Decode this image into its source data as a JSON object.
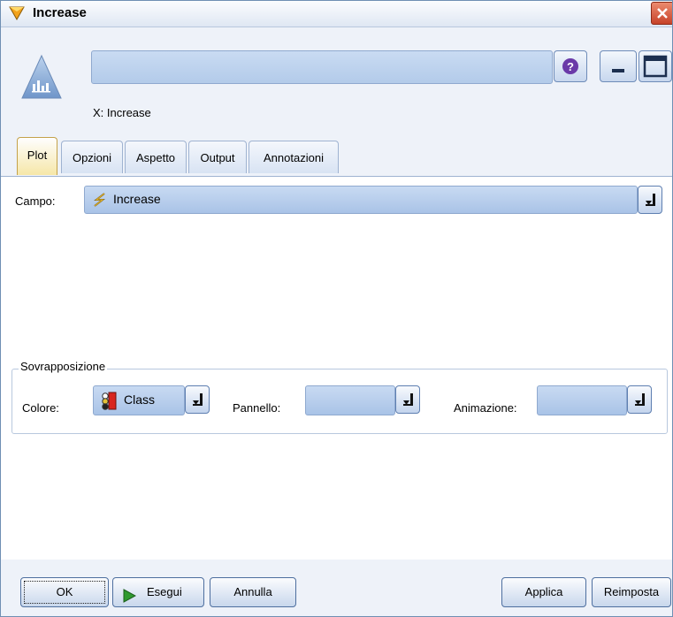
{
  "window": {
    "title": "Increase"
  },
  "header": {
    "node_name": "",
    "x_label": "X: Increase"
  },
  "tabs": [
    {
      "label": "Plot"
    },
    {
      "label": "Opzioni"
    },
    {
      "label": "Aspetto"
    },
    {
      "label": "Output"
    },
    {
      "label": "Annotazioni"
    }
  ],
  "plot": {
    "field_label": "Campo:",
    "field_value": "Increase",
    "overlay_group": "Sovrapposizione",
    "color_label": "Colore:",
    "color_value": "Class",
    "panel_label": "Pannello:",
    "panel_value": "",
    "animation_label": "Animazione:",
    "animation_value": ""
  },
  "footer": {
    "ok_label": "OK",
    "run_label": "Esegui",
    "cancel_label": "Annulla",
    "apply_label": "Applica",
    "reset_label": "Reimposta"
  },
  "icons": [
    "node-diamond-icon",
    "close-icon",
    "histogram-node-icon",
    "help-icon",
    "minimize-icon",
    "maximize-icon",
    "continuous-field-icon",
    "dropdown-icon",
    "set-field-icon",
    "play-icon"
  ]
}
